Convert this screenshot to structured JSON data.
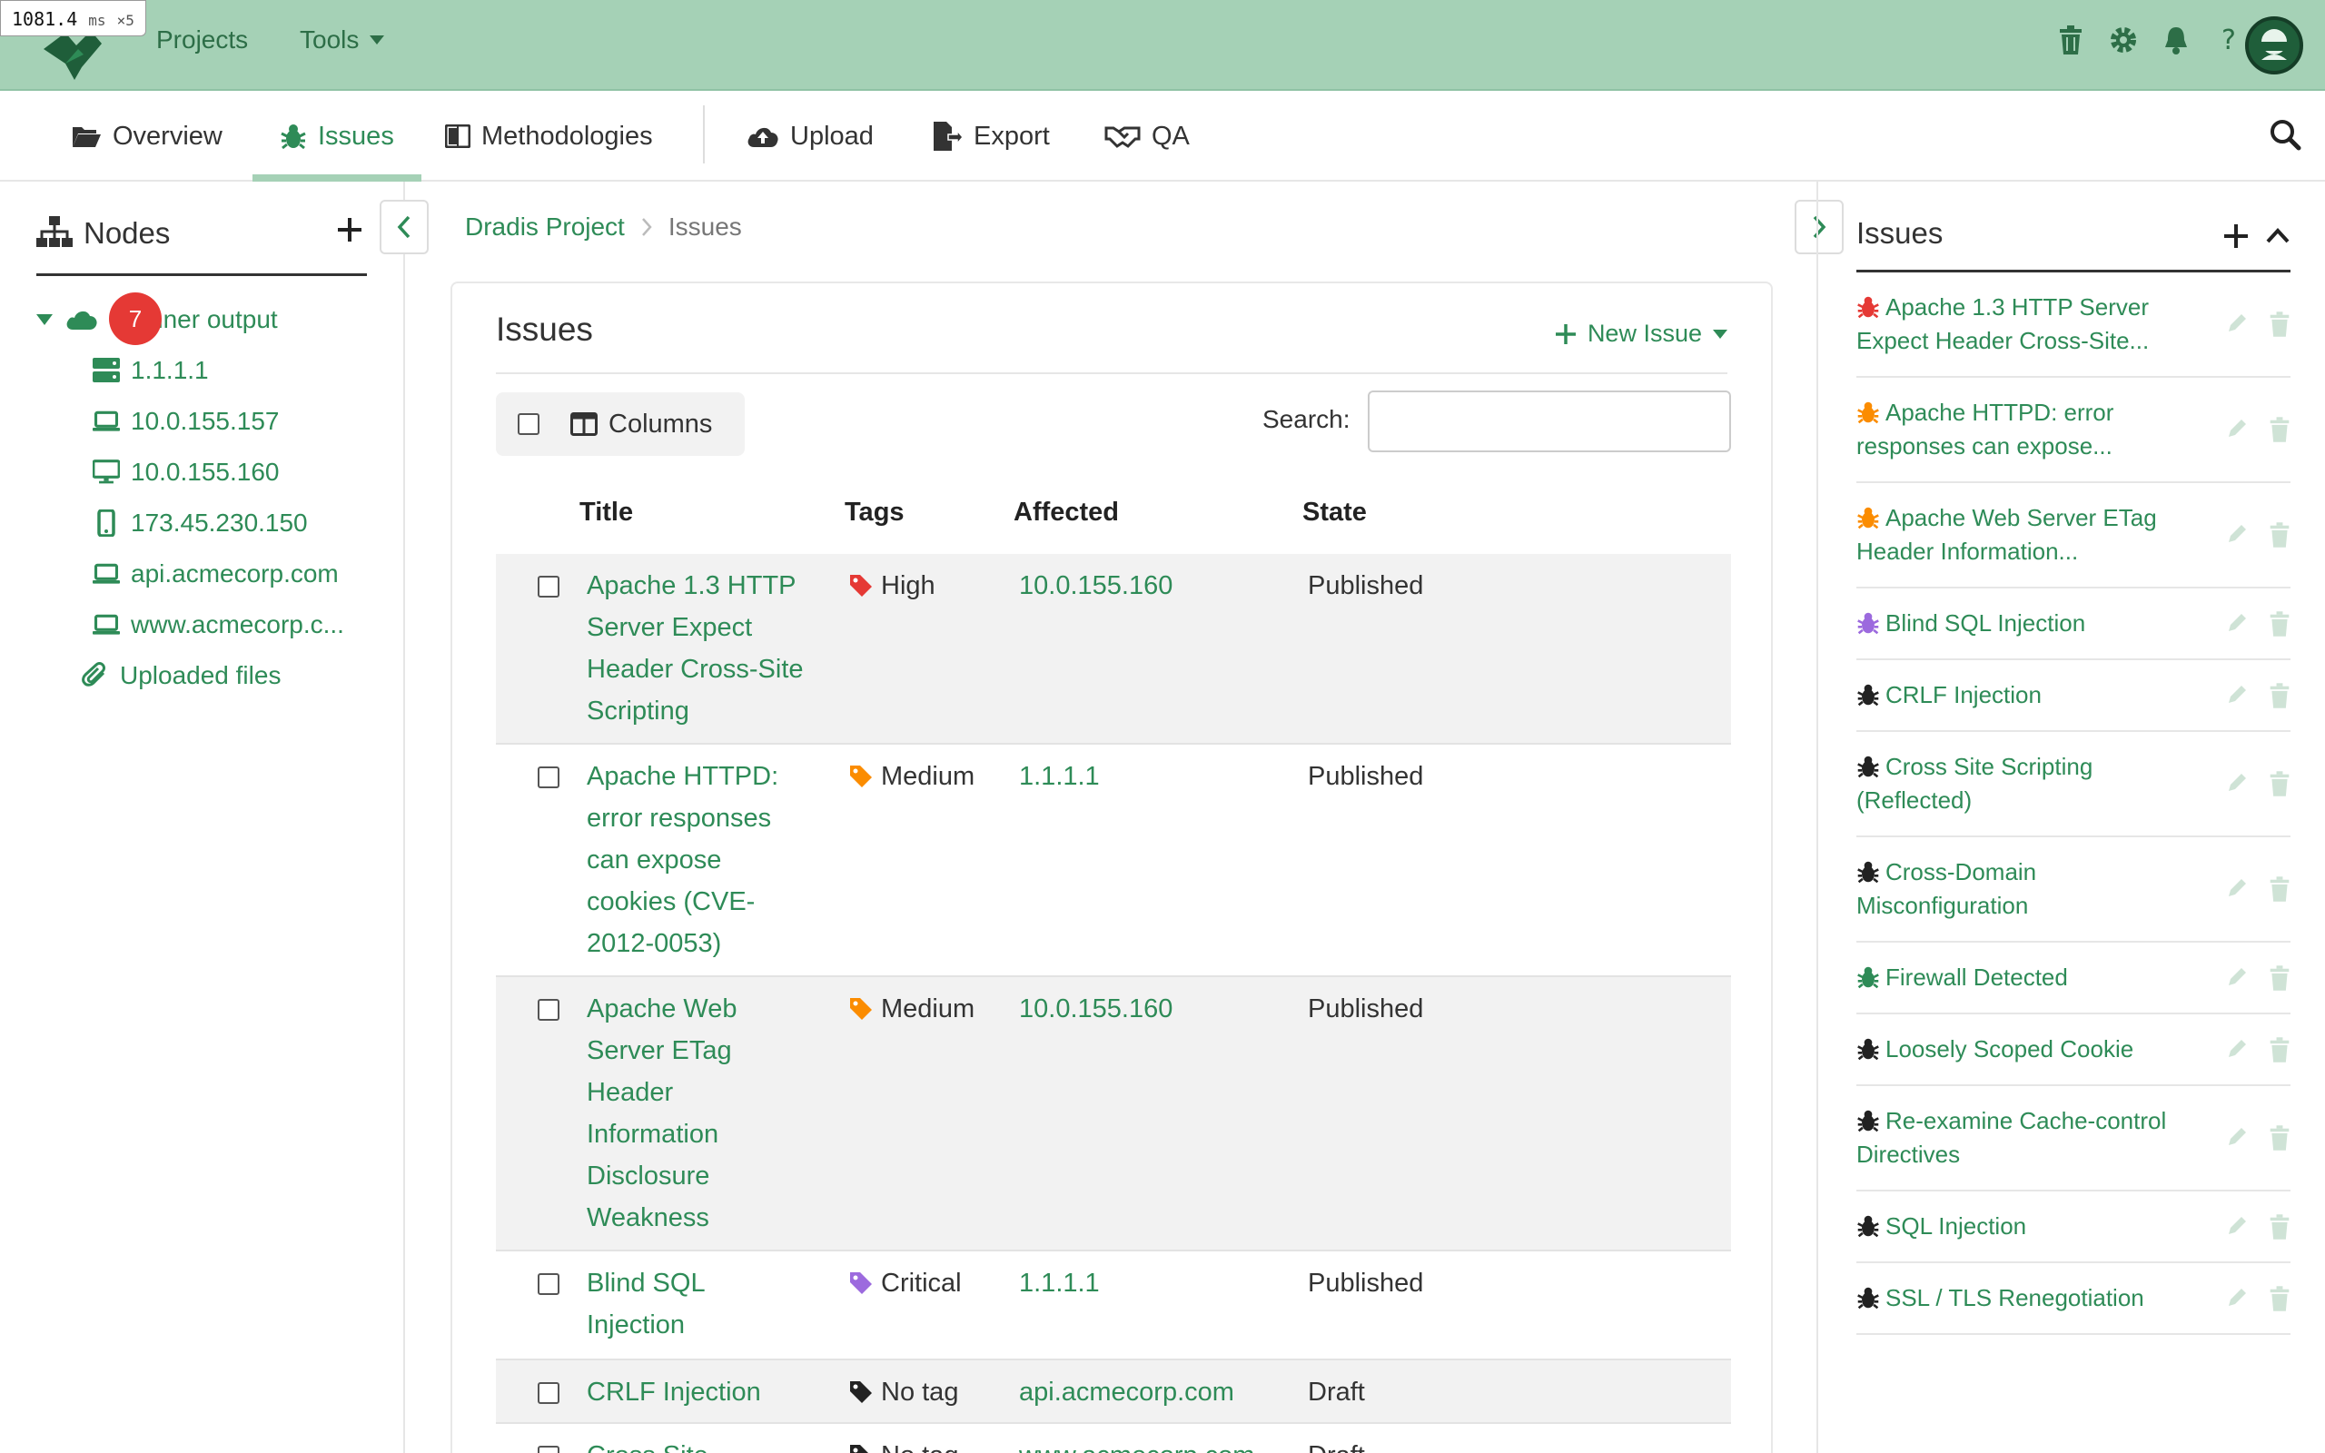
{
  "perf": {
    "value": "1081.4",
    "unit": "ms",
    "mult": "×5"
  },
  "topnav": {
    "projects": "Projects",
    "tools": "Tools"
  },
  "tabs": [
    {
      "label": "Overview"
    },
    {
      "label": "Issues"
    },
    {
      "label": "Methodologies"
    },
    {
      "label": "Upload"
    },
    {
      "label": "Export"
    },
    {
      "label": "QA"
    }
  ],
  "left": {
    "title": "Nodes",
    "badge": "7",
    "root_label": "nner output",
    "nodes": [
      "1.1.1.1",
      "10.0.155.157",
      "10.0.155.160",
      "173.45.230.150",
      "api.acmecorp.com",
      "www.acmecorp.c..."
    ],
    "uploaded": "Uploaded files"
  },
  "breadcrumb": {
    "project": "Dradis Project",
    "current": "Issues"
  },
  "main": {
    "title": "Issues",
    "new_issue": "New Issue",
    "columns": "Columns",
    "search_label": "Search:",
    "search_value": "",
    "headers": {
      "title": "Title",
      "tags": "Tags",
      "affected": "Affected",
      "state": "State"
    },
    "rows": [
      {
        "title": "Apache 1.3 HTTP Server Expect Header Cross-Site Scripting",
        "tag": "High",
        "tag_color": "#e53935",
        "affected": "10.0.155.160",
        "state": "Published"
      },
      {
        "title": "Apache HTTPD: error responses can expose cookies (CVE-2012-0053)",
        "tag": "Medium",
        "tag_color": "#fb8c00",
        "affected": "1.1.1.1",
        "state": "Published"
      },
      {
        "title": "Apache Web Server ETag Header Information Disclosure Weakness",
        "tag": "Medium",
        "tag_color": "#fb8c00",
        "affected": "10.0.155.160",
        "state": "Published"
      },
      {
        "title": "Blind SQL Injection",
        "tag": "Critical",
        "tag_color": "#9c6ade",
        "affected": "1.1.1.1",
        "state": "Published"
      },
      {
        "title": "CRLF Injection",
        "tag": "No tag",
        "tag_color": "#222222",
        "affected": "api.acmecorp.com",
        "state": "Draft"
      },
      {
        "title": "Cross Site",
        "tag": "No tag",
        "tag_color": "#222222",
        "affected": "www.acmecorp.com",
        "state": "Draft"
      }
    ]
  },
  "right": {
    "title": "Issues",
    "items": [
      {
        "label": "Apache 1.3 HTTP Server Expect Header Cross-Site...",
        "color": "#e53935"
      },
      {
        "label": "Apache HTTPD: error responses can expose...",
        "color": "#fb8c00"
      },
      {
        "label": "Apache Web Server ETag Header Information...",
        "color": "#fb8c00"
      },
      {
        "label": "Blind SQL Injection",
        "color": "#9c6ade"
      },
      {
        "label": "CRLF Injection",
        "color": "#222222"
      },
      {
        "label": "Cross Site Scripting (Reflected)",
        "color": "#222222"
      },
      {
        "label": "Cross-Domain Misconfiguration",
        "color": "#222222"
      },
      {
        "label": "Firewall Detected",
        "color": "#2e8b57"
      },
      {
        "label": "Loosely Scoped Cookie",
        "color": "#222222"
      },
      {
        "label": "Re-examine Cache-control Directives",
        "color": "#222222"
      },
      {
        "label": "SQL Injection",
        "color": "#222222"
      },
      {
        "label": "SSL / TLS Renegotiation",
        "color": "#222222"
      }
    ]
  },
  "colors": {
    "brand": "#a5d1b6",
    "link": "#2e8b57"
  }
}
